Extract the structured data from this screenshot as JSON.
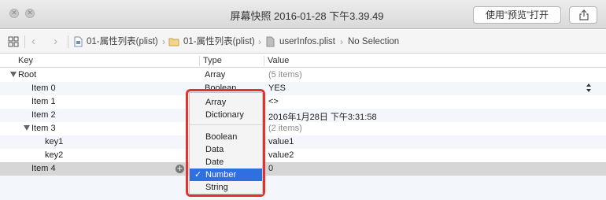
{
  "titlebar": {
    "title": "屏幕快照 2016-01-28 下午3.39.49",
    "open_button": "使用“预览”打开"
  },
  "jumpbar": {
    "crumbs": [
      "01-属性列表(plist)",
      "01-属性列表(plist)",
      "userInfos.plist",
      "No Selection"
    ]
  },
  "columns": {
    "key": "Key",
    "type": "Type",
    "value": "Value"
  },
  "rows": [
    {
      "key": "Root",
      "type": "Array",
      "value": "(5 items)"
    },
    {
      "key": "Item 0",
      "type": "Boolean",
      "value": "YES"
    },
    {
      "key": "Item 1",
      "type": "",
      "value": "<>"
    },
    {
      "key": "Item 2",
      "type": "",
      "value": "2016年1月28日 下午3:31:58"
    },
    {
      "key": "Item 3",
      "type": "",
      "value": "(2 items)"
    },
    {
      "key": "key1",
      "type": "",
      "value": "value1"
    },
    {
      "key": "key2",
      "type": "",
      "value": "value2"
    },
    {
      "key": "Item 4",
      "type": "Number",
      "value": "0"
    }
  ],
  "type_menu": {
    "items": [
      "Array",
      "Dictionary",
      "Boolean",
      "Data",
      "Date",
      "Number",
      "String"
    ],
    "selected": "Number",
    "check_mark": "✓"
  },
  "colors": {
    "highlight": "#2f6fe0",
    "annotation_box": "#e0342c"
  },
  "icons": [
    "close-icon",
    "grid-icon",
    "back-icon",
    "forward-icon",
    "file-icon",
    "folder-icon",
    "share-icon",
    "add-icon"
  ]
}
